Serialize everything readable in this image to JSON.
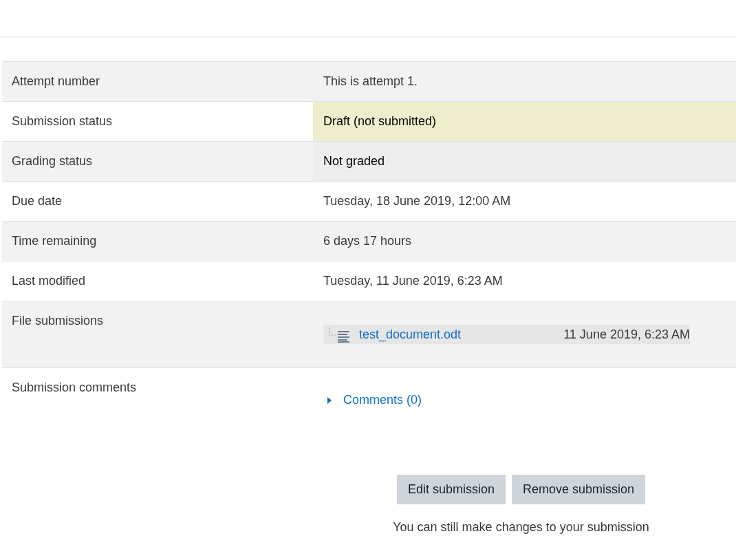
{
  "rows": [
    {
      "label": "Attempt number",
      "kind": "text",
      "value": "This is attempt 1."
    },
    {
      "label": "Submission status",
      "kind": "draft",
      "value": "Draft (not submitted)"
    },
    {
      "label": "Grading status",
      "kind": "ungraded",
      "value": "Not graded"
    },
    {
      "label": "Due date",
      "kind": "text",
      "value": "Tuesday, 18 June 2019, 12:00 AM"
    },
    {
      "label": "Time remaining",
      "kind": "text",
      "value": "6 days 17 hours"
    },
    {
      "label": "Last modified",
      "kind": "text",
      "value": "Tuesday, 11 June 2019, 6:23 AM"
    },
    {
      "label": "File submissions",
      "kind": "file",
      "file": {
        "name": "test_document.odt",
        "date": "11 June 2019, 6:23 AM"
      }
    },
    {
      "label": "Submission comments",
      "kind": "comments",
      "link": "Comments (0)",
      "expanded": false
    }
  ],
  "buttons": [
    "Edit submission",
    "Remove submission"
  ],
  "note": "You can still make changes to your submission"
}
